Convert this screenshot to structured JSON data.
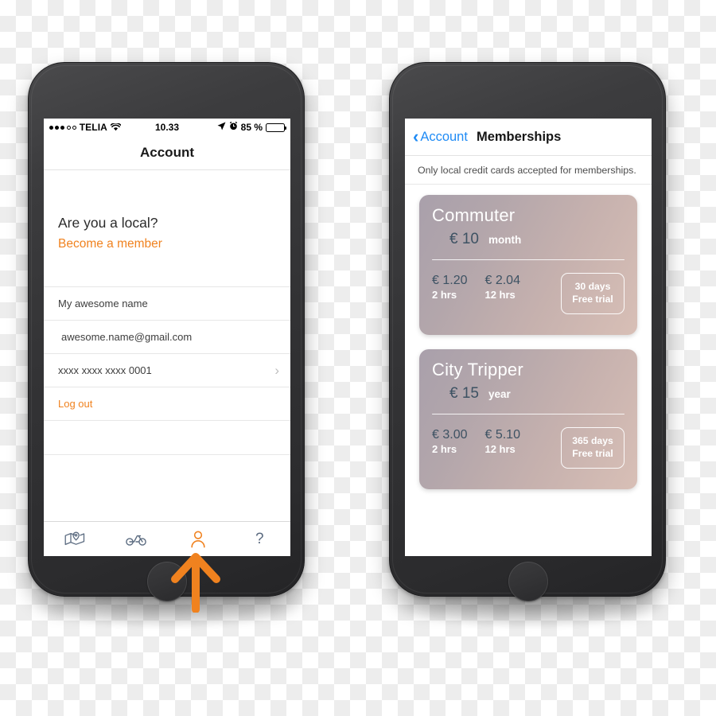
{
  "left_phone": {
    "status_bar": {
      "signal_dots_filled": 3,
      "signal_dots_hollow": 2,
      "carrier": "TELIA",
      "wifi_icon": "wifi-icon",
      "time": "10.33",
      "location_icon": "location-arrow-icon",
      "alarm_icon": "alarm-clock-icon",
      "battery_percent": "85 %",
      "battery_level": 85
    },
    "nav_title": "Account",
    "promo": {
      "heading": "Are you a local?",
      "link": "Become a member",
      "link_color": "#f0821f"
    },
    "rows": [
      {
        "label": "My awesome name",
        "chevron": false,
        "style": "normal"
      },
      {
        "label": "awesome.name@gmail.com",
        "chevron": false,
        "style": "indent"
      },
      {
        "label": "xxxx xxxx xxxx 0001",
        "chevron": true,
        "style": "normal"
      },
      {
        "label": "Log out",
        "chevron": false,
        "style": "logout"
      }
    ],
    "tab_bar": {
      "active_index": 2,
      "active_color": "#f0821f",
      "inactive_color": "#5b6b80",
      "items": [
        {
          "icon": "map-pin-icon",
          "label": ""
        },
        {
          "icon": "bicycle-icon",
          "label": ""
        },
        {
          "icon": "person-icon",
          "label": ""
        },
        {
          "icon": "question-mark-icon",
          "label": "?"
        }
      ]
    }
  },
  "right_phone": {
    "nav": {
      "back_icon": "chevron-left-icon",
      "back_label": "Account",
      "title": "Memberships",
      "accent_color": "#1f8bf5"
    },
    "notice": "Only local credit cards accepted for memberships.",
    "cards": [
      {
        "name": "Commuter",
        "price": "€ 10",
        "period": "month",
        "rates": [
          {
            "amount": "€ 1.20",
            "duration": "2 hrs"
          },
          {
            "amount": "€ 2.04",
            "duration": "12 hrs"
          }
        ],
        "trial_amount": "30 days",
        "trial_label": "Free trial"
      },
      {
        "name": "City Tripper",
        "price": "€ 15",
        "period": "year",
        "rates": [
          {
            "amount": "€ 3.00",
            "duration": "2 hrs"
          },
          {
            "amount": "€ 5.10",
            "duration": "12 hrs"
          }
        ],
        "trial_amount": "365 days",
        "trial_label": "Free trial"
      }
    ]
  },
  "annotation": {
    "arrow_icon": "arrow-up-icon",
    "arrow_color": "#f0821f"
  }
}
